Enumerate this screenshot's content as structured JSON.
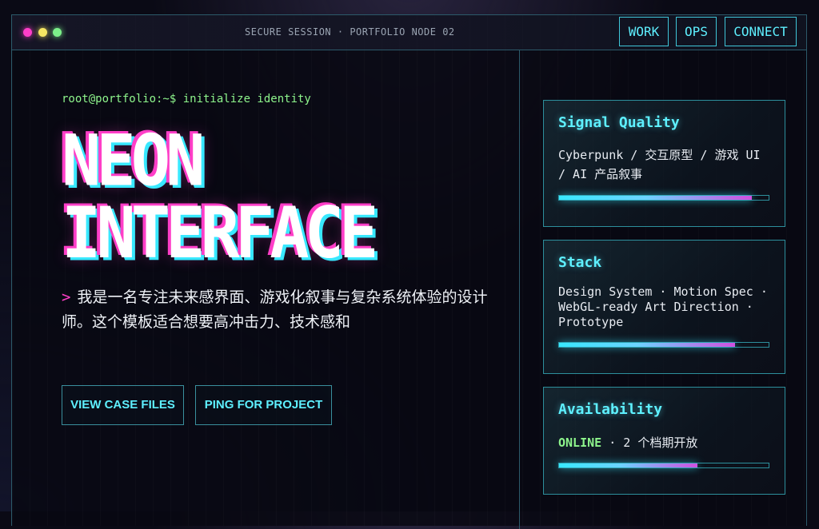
{
  "window": {
    "session_label": "SECURE SESSION · PORTFOLIO NODE 02",
    "dot_colors": [
      "#ff3ec8",
      "#f5e663",
      "#7cf08a"
    ]
  },
  "nav": {
    "work": "WORK",
    "ops": "OPS",
    "connect": "CONNECT"
  },
  "hero": {
    "prompt": "root@portfolio:~$ initialize identity",
    "title_line1": "NEON",
    "title_line2": "INTERFACE",
    "description_marker": ">",
    "description": "我是一名专注未来感界面、游戏化叙事与复杂系统体验的设计师。这个模板适合想要高冲击力、技术感和"
  },
  "buttons": {
    "view_case_files": "VIEW CASE FILES",
    "ping_for_project": "PING FOR PROJECT"
  },
  "cards": {
    "signal": {
      "title": "Signal Quality",
      "text": "Cyberpunk / 交互原型 / 游戏 UI / AI 产品叙事",
      "progress": 0.92
    },
    "stack": {
      "title": "Stack",
      "text": "Design System · Motion Spec · WebGL-ready Art Direction · Prototype",
      "progress": 0.84
    },
    "availability": {
      "title": "Availability",
      "status": "ONLINE",
      "text": " · 2 个档期开放",
      "progress": 0.66
    }
  },
  "colors": {
    "accent_cyan": "#5ef0ff",
    "accent_magenta": "#ff3ec8",
    "accent_green": "#8ef58c",
    "border": "#2c5a6a"
  }
}
